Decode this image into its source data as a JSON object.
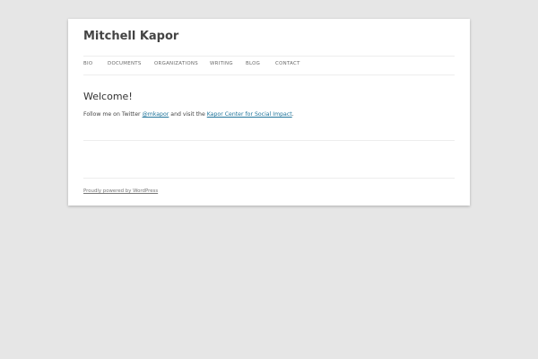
{
  "site": {
    "title": "Mitchell Kapor"
  },
  "nav": {
    "items": [
      {
        "label": "BIO"
      },
      {
        "label": "DOCUMENTS"
      },
      {
        "label": "ORGANIZATIONS"
      },
      {
        "label": "WRITING"
      },
      {
        "label": "BLOG"
      },
      {
        "label": "CONTACT"
      }
    ]
  },
  "entry": {
    "title": "Welcome!",
    "text_before": "Follow me on Twitter ",
    "twitter_link": "@mkapor",
    "text_middle": " and visit the ",
    "center_link": "Kapor Center for Social Impact",
    "text_after": "."
  },
  "footer": {
    "credit": "Proudly powered by WordPress"
  },
  "colors": {
    "background": "#e6e6e6",
    "page": "#ffffff",
    "link": "#21759b",
    "title": "#444444"
  }
}
